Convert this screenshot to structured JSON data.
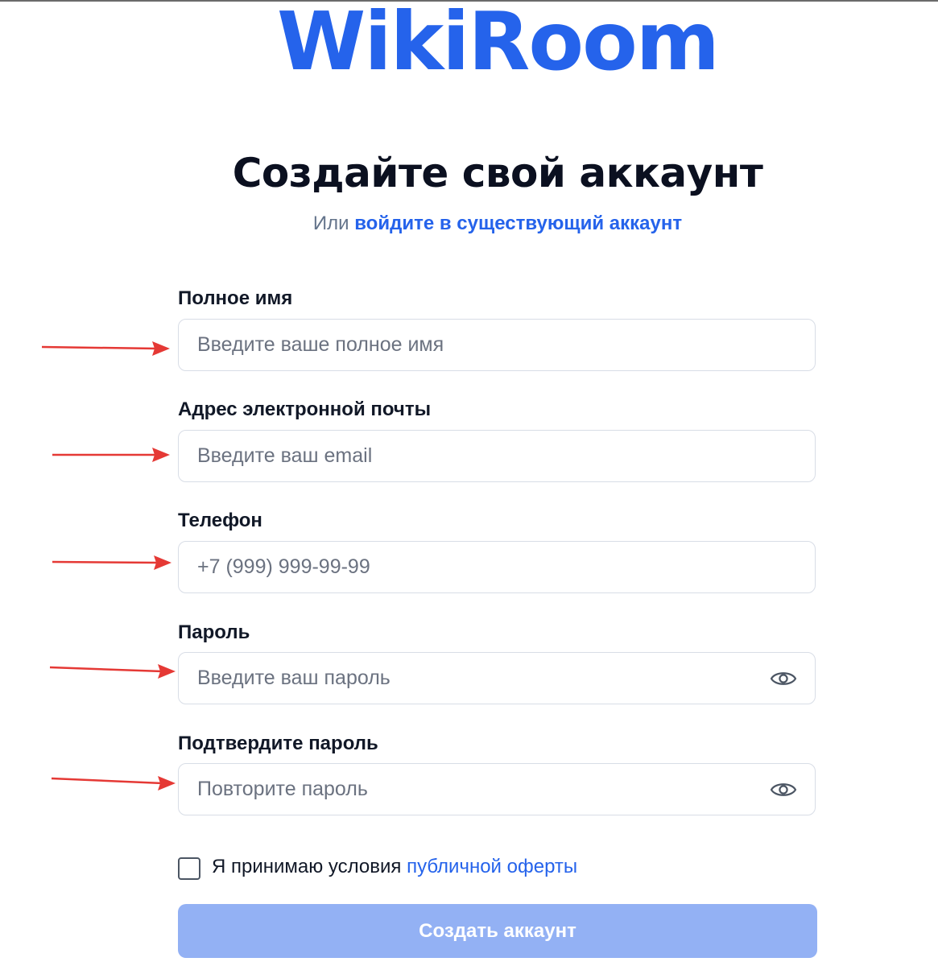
{
  "brand": {
    "logo_text": "WikiRoom",
    "accent_color": "#2563eb"
  },
  "heading": {
    "title": "Создайте свой аккаунт",
    "subtitle_prefix": "Или ",
    "login_link": "войдите в существующий аккаунт"
  },
  "form": {
    "fields": [
      {
        "label": "Полное имя",
        "placeholder": "Введите ваше полное имя",
        "value": "",
        "type": "text"
      },
      {
        "label": "Адрес электронной почты",
        "placeholder": "Введите ваш email",
        "value": "",
        "type": "email"
      },
      {
        "label": "Телефон",
        "placeholder": "+7 (999) 999-99-99",
        "value": "",
        "type": "tel"
      },
      {
        "label": "Пароль",
        "placeholder": "Введите ваш пароль",
        "value": "",
        "type": "password",
        "icon": "eye-icon"
      },
      {
        "label": "Подтвердите пароль",
        "placeholder": "Повторите пароль",
        "value": "",
        "type": "password",
        "icon": "eye-icon"
      }
    ],
    "terms": {
      "checked": false,
      "prefix": "Я принимаю условия ",
      "link": "публичной оферты"
    },
    "submit_label": "Создать аккаунт",
    "submit_color": "#93b1f4"
  },
  "annotations": {
    "arrow_color": "#e53935"
  }
}
